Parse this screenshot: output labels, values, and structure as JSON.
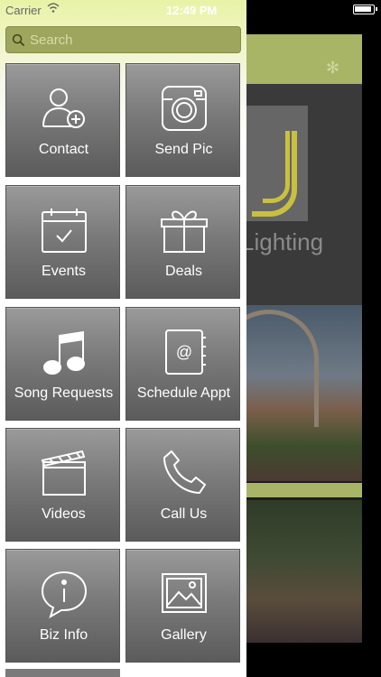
{
  "status_bar": {
    "carrier": "Carrier",
    "time": "12:49 PM"
  },
  "search": {
    "placeholder": "Search"
  },
  "menu": {
    "tiles": [
      {
        "label": "Contact",
        "icon": "add-contact-icon"
      },
      {
        "label": "Send Pic",
        "icon": "camera-icon"
      },
      {
        "label": "Events",
        "icon": "calendar-icon"
      },
      {
        "label": "Deals",
        "icon": "gift-icon"
      },
      {
        "label": "Song Requests",
        "icon": "music-note-icon"
      },
      {
        "label": "Schedule Appt",
        "icon": "address-book-icon"
      },
      {
        "label": "Videos",
        "icon": "clapperboard-icon"
      },
      {
        "label": "Call Us",
        "icon": "phone-icon"
      },
      {
        "label": "Biz Info",
        "icon": "info-bubble-icon"
      },
      {
        "label": "Gallery",
        "icon": "picture-icon"
      }
    ]
  },
  "background": {
    "logo_text": "Lighting",
    "accent_color": "#a8b466"
  }
}
